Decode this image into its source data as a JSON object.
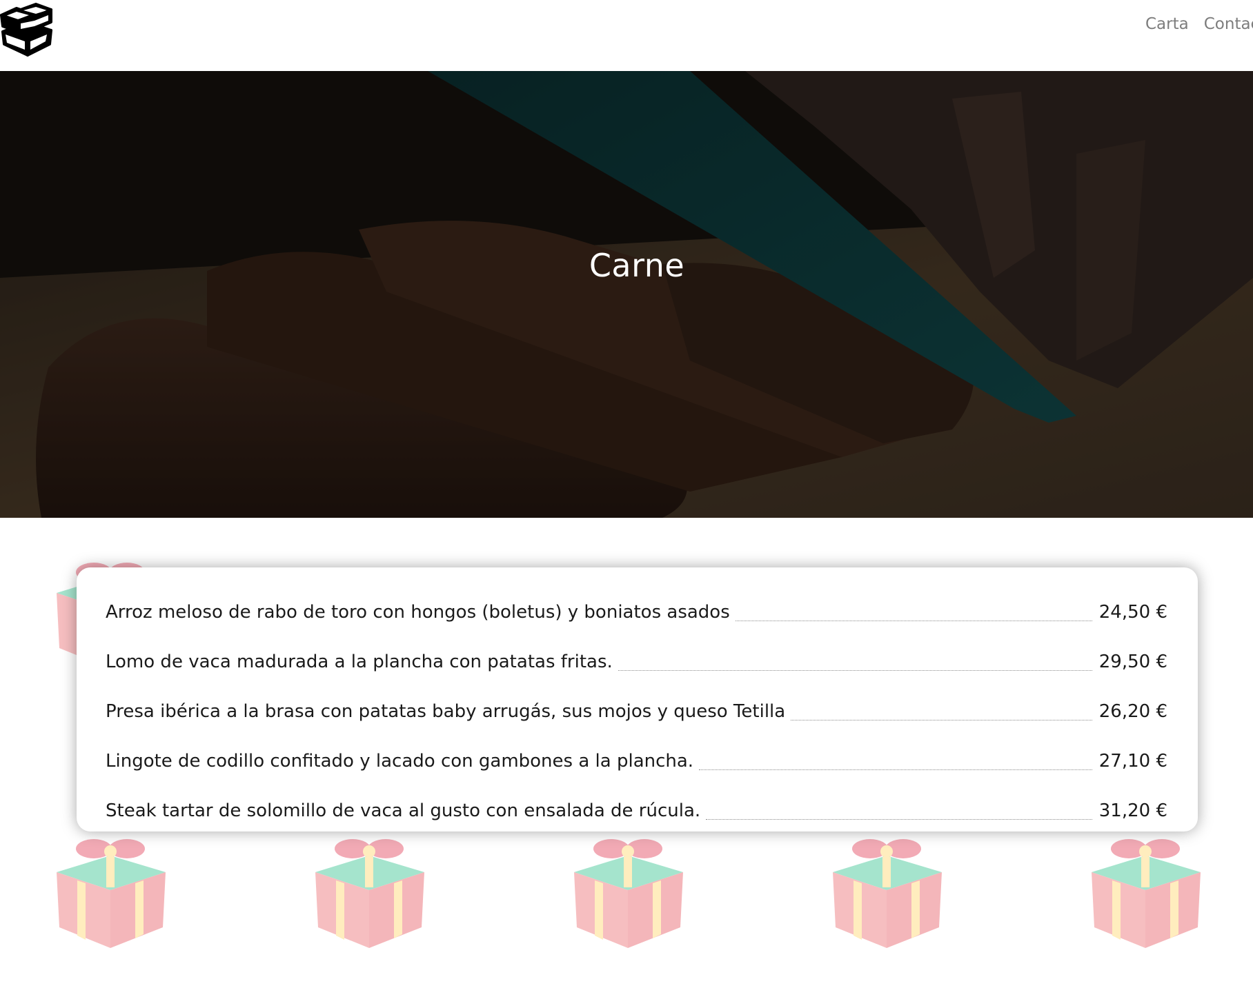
{
  "header": {
    "logo_icon": "boxes-logo-icon",
    "nav": [
      {
        "label": "Carta"
      },
      {
        "label": "Contacto"
      }
    ]
  },
  "hero": {
    "title": "Carne"
  },
  "menu": {
    "items": [
      {
        "dish": "Arroz meloso de rabo de toro con hongos (boletus) y boniatos asados",
        "price": "24,50 €"
      },
      {
        "dish": "Lomo de vaca madurada a la plancha con patatas fritas.",
        "price": "29,50 €"
      },
      {
        "dish": "Presa ibérica a la brasa con patatas baby arrugás, sus mojos y queso Tetilla",
        "price": "26,20 €"
      },
      {
        "dish": "Lingote de codillo confitado y lacado con gambones a la plancha.",
        "price": "27,10 €"
      },
      {
        "dish": "Steak tartar de solomillo de vaca al gusto con ensalada de rúcula.",
        "price": "31,20 €"
      }
    ]
  },
  "decor": {
    "gift_icon": "gift-box-icon",
    "colors": {
      "gift_box": "#f08a8e",
      "gift_lid": "#5ccfa6",
      "gift_ribbon": "#ffe08a",
      "gift_bow": "#e8657a"
    }
  }
}
